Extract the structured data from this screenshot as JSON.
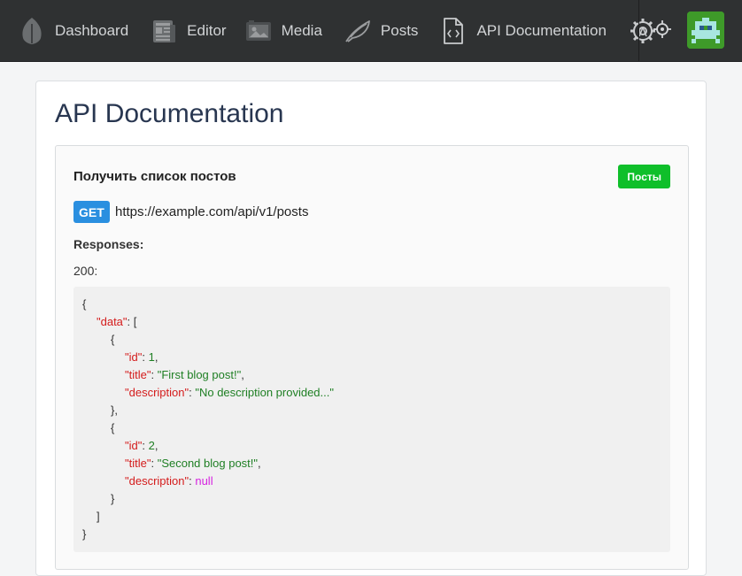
{
  "nav": {
    "items": [
      {
        "label": "Dashboard",
        "icon": "leaf-dark-icon"
      },
      {
        "label": "Editor",
        "icon": "newspaper-icon"
      },
      {
        "label": "Media",
        "icon": "image-icon"
      },
      {
        "label": "Posts",
        "icon": "feather-icon"
      },
      {
        "label": "API Documentation",
        "icon": "code-file-icon"
      }
    ],
    "settings_icon": "gear-icon",
    "target_icon": "crosshair-icon",
    "avatar_icon": "pixel-avatar-icon"
  },
  "page": {
    "title": "API Documentation"
  },
  "endpoint": {
    "title": "Получить список постов",
    "tag": "Посты",
    "method": "GET",
    "url": "https://example.com/api/v1/posts",
    "responses_label": "Responses:",
    "status": "200:"
  },
  "code": {
    "brace_open": "{",
    "data_key": "\"data\"",
    "bracket_open": "[",
    "obj_open": "{",
    "obj_close_comma": "},",
    "obj_close": "}",
    "bracket_close": "]",
    "brace_close": "}",
    "items": [
      {
        "id_key": "\"id\"",
        "id": "1",
        "title_key": "\"title\"",
        "title": "\"First blog post!\"",
        "desc_key": "\"description\"",
        "desc": "\"No description provided...\""
      },
      {
        "id_key": "\"id\"",
        "id": "2",
        "title_key": "\"title\"",
        "title": "\"Second blog post!\"",
        "desc_key": "\"description\"",
        "desc": "null"
      }
    ]
  },
  "colors": {
    "accent": "#0fbf2a",
    "method": "#2a8fe0",
    "nav_bg": "#2f3132",
    "key": "#d41c1c",
    "string": "#1f7f24",
    "null": "#d622e0"
  }
}
